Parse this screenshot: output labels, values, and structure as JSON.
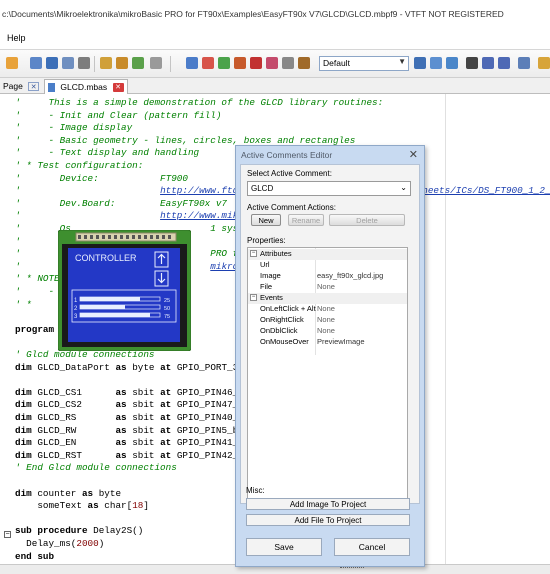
{
  "window": {
    "title": "c:\\Documents\\Mikroelektronika\\mikroBasic PRO for FT90x\\Examples\\EasyFT90x V7\\GLCD\\GLCD.mbpf9 - VTFT NOT REGISTERED"
  },
  "menu": {
    "items": [
      "Help"
    ]
  },
  "toolbar": {
    "profile_value": "Default"
  },
  "tabs": [
    {
      "label": "Page"
    },
    {
      "label": "GLCD.mbas"
    }
  ],
  "code": {
    "lines": [
      {
        "parts": [
          {
            "c": "cmt",
            "t": "'     This is a simple demonstration of the GLCD library routines:"
          }
        ]
      },
      {
        "parts": [
          {
            "c": "cmt",
            "t": "'     - Init and Clear (pattern fill)"
          }
        ]
      },
      {
        "parts": [
          {
            "c": "cmt",
            "t": "'     - Image display"
          }
        ]
      },
      {
        "parts": [
          {
            "c": "cmt",
            "t": "'     - Basic geometry - lines, circles, boxes and rectangles"
          }
        ]
      },
      {
        "parts": [
          {
            "c": "cmt",
            "t": "'     - Text display and handling"
          }
        ]
      },
      {
        "parts": [
          {
            "c": "cmt",
            "t": "' * Test configuration:"
          }
        ]
      },
      {
        "parts": [
          {
            "c": "cmt",
            "t": "'       Device:           FT900"
          }
        ]
      },
      {
        "parts": [
          {
            "c": "cmt",
            "t": "'                         "
          },
          {
            "c": "link",
            "t": "http://www.ftdichip.com/Support/Documents/DataSheets/ICs/DS_FT900_1_2_3.pdf"
          }
        ]
      },
      {
        "parts": [
          {
            "c": "cmt",
            "t": "'       Dev.Board:        EasyFT90x v7"
          }
        ]
      },
      {
        "parts": [
          {
            "c": "cmt",
            "t": "'                         "
          },
          {
            "c": "link",
            "t": "http://www.mikroe.com/"
          }
        ]
      },
      {
        "parts": [
          {
            "c": "cmt",
            "t": "'       Os                         1 system"
          }
        ]
      },
      {
        "parts": [
          {
            "c": "cmt",
            "t": "'       ex"
          }
        ]
      },
      {
        "parts": [
          {
            "c": "cmt",
            "t": "'       SW                         PRO for"
          }
        ]
      },
      {
        "parts": [
          {
            "c": "cmt",
            "t": "'                                  "
          },
          {
            "c": "link",
            "t": "mikroe."
          }
        ]
      },
      {
        "parts": [
          {
            "c": "cmt",
            "t": "' * NOTE"
          }
        ]
      },
      {
        "parts": [
          {
            "c": "cmt",
            "t": "'     -"
          }
        ]
      },
      {
        "parts": [
          {
            "c": "cmt",
            "t": "' *"
          }
        ]
      },
      {
        "parts": [
          {
            "c": "plain",
            "t": ""
          }
        ]
      },
      {
        "parts": [
          {
            "c": "kw",
            "t": "program"
          }
        ]
      },
      {
        "parts": [
          {
            "c": "plain",
            "t": ""
          }
        ]
      },
      {
        "parts": [
          {
            "c": "cmt",
            "t": "' Glcd module connections"
          }
        ]
      },
      {
        "parts": [
          {
            "c": "kw",
            "t": "dim"
          },
          {
            "c": "plain",
            "t": " GLCD_DataPort "
          },
          {
            "c": "kw",
            "t": "as"
          },
          {
            "c": "plain",
            "t": " byte "
          },
          {
            "c": "kw",
            "t": "at"
          },
          {
            "c": "plain",
            "t": " GPIO_PORT_32_"
          }
        ]
      },
      {
        "parts": [
          {
            "c": "plain",
            "t": ""
          }
        ]
      },
      {
        "parts": [
          {
            "c": "kw",
            "t": "dim"
          },
          {
            "c": "plain",
            "t": " GLCD_CS1      "
          },
          {
            "c": "kw",
            "t": "as"
          },
          {
            "c": "plain",
            "t": " sbit "
          },
          {
            "c": "kw",
            "t": "at"
          },
          {
            "c": "plain",
            "t": " GPIO_PIN46_bi"
          }
        ]
      },
      {
        "parts": [
          {
            "c": "kw",
            "t": "dim"
          },
          {
            "c": "plain",
            "t": " GLCD_CS2      "
          },
          {
            "c": "kw",
            "t": "as"
          },
          {
            "c": "plain",
            "t": " sbit "
          },
          {
            "c": "kw",
            "t": "at"
          },
          {
            "c": "plain",
            "t": " GPIO_PIN47_bi"
          }
        ]
      },
      {
        "parts": [
          {
            "c": "kw",
            "t": "dim"
          },
          {
            "c": "plain",
            "t": " GLCD_RS       "
          },
          {
            "c": "kw",
            "t": "as"
          },
          {
            "c": "plain",
            "t": " sbit "
          },
          {
            "c": "kw",
            "t": "at"
          },
          {
            "c": "plain",
            "t": " GPIO_PIN40_bi"
          }
        ]
      },
      {
        "parts": [
          {
            "c": "kw",
            "t": "dim"
          },
          {
            "c": "plain",
            "t": " GLCD_RW       "
          },
          {
            "c": "kw",
            "t": "as"
          },
          {
            "c": "plain",
            "t": " sbit "
          },
          {
            "c": "kw",
            "t": "at"
          },
          {
            "c": "plain",
            "t": " GPIO_PIN5_bit"
          }
        ]
      },
      {
        "parts": [
          {
            "c": "kw",
            "t": "dim"
          },
          {
            "c": "plain",
            "t": " GLCD_EN       "
          },
          {
            "c": "kw",
            "t": "as"
          },
          {
            "c": "plain",
            "t": " sbit "
          },
          {
            "c": "kw",
            "t": "at"
          },
          {
            "c": "plain",
            "t": " GPIO_PIN41_bi"
          }
        ]
      },
      {
        "parts": [
          {
            "c": "kw",
            "t": "dim"
          },
          {
            "c": "plain",
            "t": " GLCD_RST      "
          },
          {
            "c": "kw",
            "t": "as"
          },
          {
            "c": "plain",
            "t": " sbit "
          },
          {
            "c": "kw",
            "t": "at"
          },
          {
            "c": "plain",
            "t": " GPIO_PIN42_bi"
          }
        ]
      },
      {
        "parts": [
          {
            "c": "cmt",
            "t": "' End Glcd module connections"
          }
        ]
      },
      {
        "parts": [
          {
            "c": "plain",
            "t": ""
          }
        ]
      },
      {
        "parts": [
          {
            "c": "kw",
            "t": "dim"
          },
          {
            "c": "plain",
            "t": " counter "
          },
          {
            "c": "kw",
            "t": "as"
          },
          {
            "c": "plain",
            "t": " byte"
          }
        ]
      },
      {
        "parts": [
          {
            "c": "plain",
            "t": "    someText "
          },
          {
            "c": "kw",
            "t": "as"
          },
          {
            "c": "plain",
            "t": " char["
          },
          {
            "c": "num",
            "t": "18"
          },
          {
            "c": "plain",
            "t": "]"
          }
        ]
      },
      {
        "parts": [
          {
            "c": "plain",
            "t": ""
          }
        ]
      },
      {
        "parts": [
          {
            "c": "kw",
            "t": "sub procedure"
          },
          {
            "c": "plain",
            "t": " Delay2S()"
          }
        ]
      },
      {
        "parts": [
          {
            "c": "plain",
            "t": "  Delay_ms("
          },
          {
            "c": "num",
            "t": "2000"
          },
          {
            "c": "plain",
            "t": ")"
          }
        ]
      },
      {
        "parts": [
          {
            "c": "kw",
            "t": "end sub"
          }
        ]
      }
    ]
  },
  "glcd_preview": {
    "header": "CONTROLLER",
    "bar_labels": [
      "1",
      "2",
      "3"
    ],
    "bar_values": [
      "25",
      "50",
      "75"
    ]
  },
  "dialog": {
    "title": "Active Comments Editor",
    "select_label": "Select Active Comment:",
    "select_value": "GLCD",
    "actions_label": "Active Comment Actions:",
    "btn_new": "New",
    "btn_rename": "Rename",
    "btn_delete": "Delete",
    "properties_label": "Properties:",
    "groups": [
      {
        "name": "Attributes",
        "rows": [
          {
            "name": "Url",
            "value": ""
          },
          {
            "name": "Image",
            "value": "easy_ft90x_glcd.jpg"
          },
          {
            "name": "File",
            "value": "None"
          }
        ]
      },
      {
        "name": "Events",
        "rows": [
          {
            "name": "OnLeftClick + Alt",
            "value": "None"
          },
          {
            "name": "OnRightClick",
            "value": "None"
          },
          {
            "name": "OnDblClick",
            "value": "None"
          },
          {
            "name": "OnMouseOver",
            "value": "PreviewImage"
          }
        ]
      }
    ],
    "misc_label": "Misc:",
    "btn_add_image": "Add Image To Project",
    "btn_add_file": "Add File To Project",
    "btn_save": "Save",
    "btn_cancel": "Cancel"
  },
  "colors": {
    "comment": "#008000",
    "dialog_bg": "#c8daf1",
    "glcd_blue": "#2338c6"
  }
}
